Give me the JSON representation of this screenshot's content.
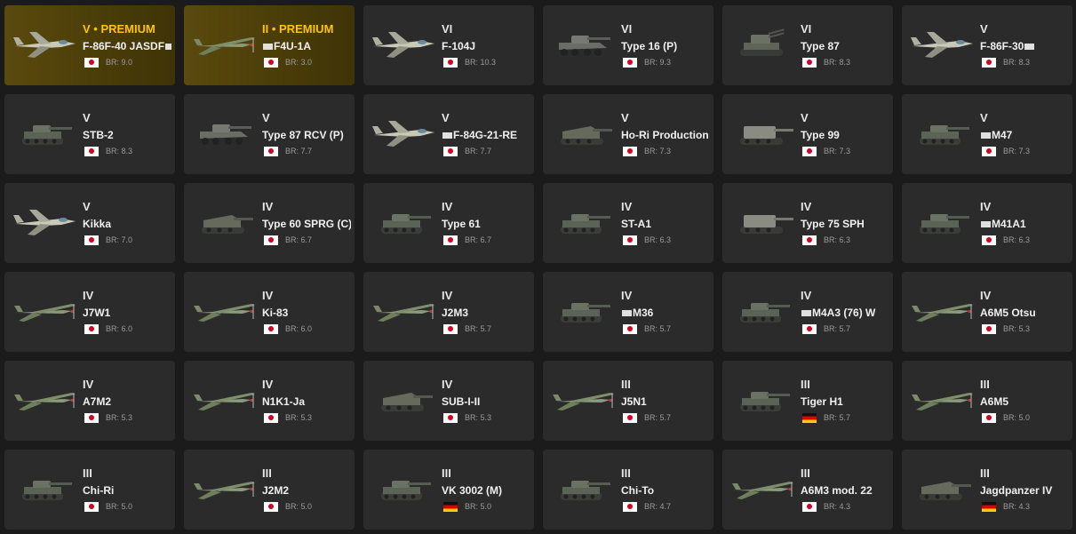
{
  "vehicles": [
    {
      "rank": "V",
      "premium": "PREMIUM",
      "name": "F-86F-40 JASDF",
      "tag_after": true,
      "flag": "jp",
      "br": "BR: 9.0",
      "icon": "jet-aircraft-icon"
    },
    {
      "rank": "II",
      "premium": "PREMIUM",
      "name": "F4U-1A",
      "tag_before": true,
      "flag": "jp",
      "br": "BR: 3.0",
      "icon": "prop-aircraft-icon"
    },
    {
      "rank": "VI",
      "name": "F-104J",
      "flag": "jp",
      "br": "BR: 10.3",
      "icon": "jet-aircraft-icon"
    },
    {
      "rank": "VI",
      "name": "Type 16 (P)",
      "flag": "jp",
      "br": "BR: 9.3",
      "icon": "wheeled-vehicle-icon"
    },
    {
      "rank": "VI",
      "name": "Type 87",
      "flag": "jp",
      "br": "BR: 8.3",
      "icon": "spaa-icon"
    },
    {
      "rank": "V",
      "name": "F-86F-30",
      "tag_after": true,
      "flag": "jp",
      "br": "BR: 8.3",
      "icon": "jet-aircraft-icon"
    },
    {
      "rank": "V",
      "name": "STB-2",
      "flag": "jp",
      "br": "BR: 8.3",
      "icon": "tank-icon"
    },
    {
      "rank": "V",
      "name": "Type 87 RCV (P)",
      "flag": "jp",
      "br": "BR: 7.7",
      "icon": "wheeled-vehicle-icon"
    },
    {
      "rank": "V",
      "name": "F-84G-21-RE",
      "tag_before": true,
      "flag": "jp",
      "br": "BR: 7.7",
      "icon": "jet-aircraft-icon"
    },
    {
      "rank": "V",
      "name": "Ho-Ri Production",
      "flag": "jp",
      "br": "BR: 7.3",
      "icon": "tank-destroyer-icon"
    },
    {
      "rank": "V",
      "name": "Type 99",
      "flag": "jp",
      "br": "BR: 7.3",
      "icon": "spg-icon"
    },
    {
      "rank": "V",
      "name": "M47",
      "tag_before": true,
      "flag": "jp",
      "br": "BR: 7.3",
      "icon": "tank-icon"
    },
    {
      "rank": "V",
      "name": "Kikka",
      "flag": "jp",
      "br": "BR: 7.0",
      "icon": "jet-aircraft-icon"
    },
    {
      "rank": "IV",
      "name": "Type 60 SPRG (C)",
      "flag": "jp",
      "br": "BR: 6.7",
      "icon": "tank-destroyer-icon"
    },
    {
      "rank": "IV",
      "name": "Type 61",
      "flag": "jp",
      "br": "BR: 6.7",
      "icon": "tank-icon"
    },
    {
      "rank": "IV",
      "name": "ST-A1",
      "flag": "jp",
      "br": "BR: 6.3",
      "icon": "tank-icon"
    },
    {
      "rank": "IV",
      "name": "Type 75 SPH",
      "flag": "jp",
      "br": "BR: 6.3",
      "icon": "spg-icon"
    },
    {
      "rank": "IV",
      "name": "M41A1",
      "tag_before": true,
      "flag": "jp",
      "br": "BR: 6.3",
      "icon": "tank-icon"
    },
    {
      "rank": "IV",
      "name": "J7W1",
      "flag": "jp",
      "br": "BR: 6.0",
      "icon": "prop-aircraft-icon"
    },
    {
      "rank": "IV",
      "name": "Ki-83",
      "flag": "jp",
      "br": "BR: 6.0",
      "icon": "prop-aircraft-icon"
    },
    {
      "rank": "IV",
      "name": "J2M3",
      "flag": "jp",
      "br": "BR: 5.7",
      "icon": "prop-aircraft-icon"
    },
    {
      "rank": "IV",
      "name": "M36",
      "tag_before": true,
      "flag": "jp",
      "br": "BR: 5.7",
      "icon": "tank-icon"
    },
    {
      "rank": "IV",
      "name": "M4A3 (76) W",
      "tag_before": true,
      "flag": "jp",
      "br": "BR: 5.7",
      "icon": "tank-icon"
    },
    {
      "rank": "IV",
      "name": "A6M5 Otsu",
      "flag": "jp",
      "br": "BR: 5.3",
      "icon": "prop-aircraft-icon"
    },
    {
      "rank": "IV",
      "name": "A7M2",
      "flag": "jp",
      "br": "BR: 5.3",
      "icon": "prop-aircraft-icon"
    },
    {
      "rank": "IV",
      "name": "N1K1-Ja",
      "flag": "jp",
      "br": "BR: 5.3",
      "icon": "prop-aircraft-icon"
    },
    {
      "rank": "IV",
      "name": "SUB-I-II",
      "flag": "jp",
      "br": "BR: 5.3",
      "icon": "tank-destroyer-icon"
    },
    {
      "rank": "III",
      "name": "J5N1",
      "flag": "jp",
      "br": "BR: 5.7",
      "icon": "prop-aircraft-icon"
    },
    {
      "rank": "III",
      "name": "Tiger H1",
      "flag": "de",
      "br": "BR: 5.7",
      "icon": "tank-icon"
    },
    {
      "rank": "III",
      "name": "A6M5",
      "flag": "jp",
      "br": "BR: 5.0",
      "icon": "prop-aircraft-icon"
    },
    {
      "rank": "III",
      "name": "Chi-Ri",
      "flag": "jp",
      "br": "BR: 5.0",
      "icon": "tank-icon"
    },
    {
      "rank": "III",
      "name": "J2M2",
      "flag": "jp",
      "br": "BR: 5.0",
      "icon": "prop-aircraft-icon"
    },
    {
      "rank": "III",
      "name": "VK 3002 (M)",
      "flag": "de",
      "br": "BR: 5.0",
      "icon": "tank-icon"
    },
    {
      "rank": "III",
      "name": "Chi-To",
      "flag": "jp",
      "br": "BR: 4.7",
      "icon": "tank-icon"
    },
    {
      "rank": "III",
      "name": "A6M3 mod. 22",
      "flag": "jp",
      "br": "BR: 4.3",
      "icon": "prop-aircraft-icon"
    },
    {
      "rank": "III",
      "name": "Jagdpanzer IV",
      "flag": "de",
      "br": "BR: 4.3",
      "icon": "tank-destroyer-icon"
    }
  ]
}
